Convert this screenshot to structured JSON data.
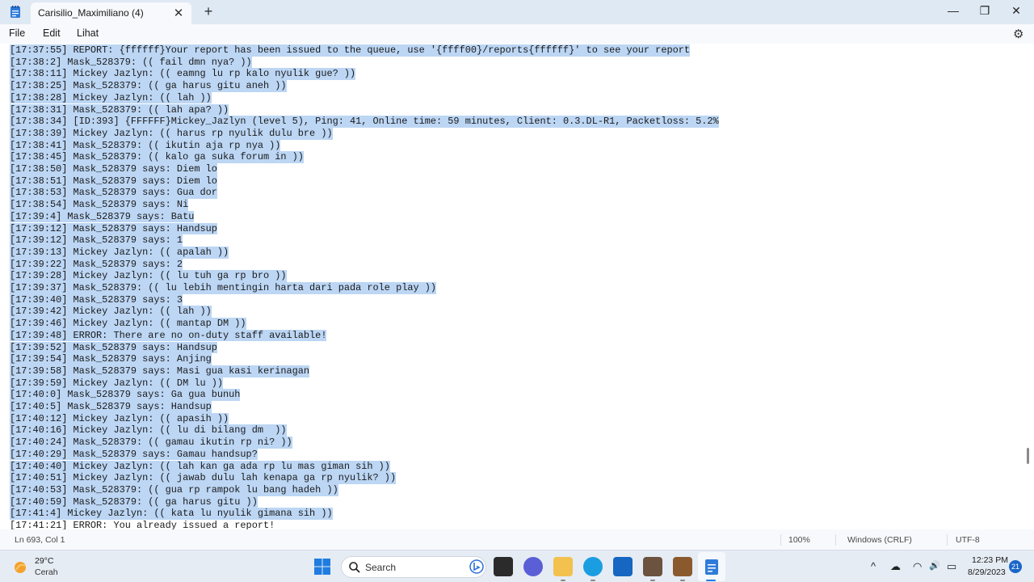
{
  "window": {
    "tab_title": "Carisilio_Maximiliano (4)",
    "close_tab_glyph": "✕",
    "new_tab_glyph": "+",
    "minimize_glyph": "—",
    "maximize_glyph": "❐",
    "close_glyph": "✕"
  },
  "menu": {
    "file": "File",
    "edit": "Edit",
    "view": "Lihat",
    "settings_icon": "⚙"
  },
  "editor": {
    "selection_color": "#bcd6f4",
    "lines": [
      "[17:37:55] REPORT: {ffffff}Your report has been issued to the queue, use '{ffff00}/reports{ffffff}' to see your report",
      "[17:38:2] Mask_528379: (( fail dmn nya? ))",
      "[17:38:11] Mickey Jazlyn: (( eamng lu rp kalo nyulik gue? ))",
      "[17:38:25] Mask_528379: (( ga harus gitu aneh ))",
      "[17:38:28] Mickey Jazlyn: (( lah ))",
      "[17:38:31] Mask_528379: (( lah apa? ))",
      "[17:38:34] [ID:393] {FFFFFF}Mickey_Jazlyn (level 5), Ping: 41, Online time: 59 minutes, Client: 0.3.DL-R1, Packetloss: 5.2%",
      "[17:38:39] Mickey Jazlyn: (( harus rp nyulik dulu bre ))",
      "[17:38:41] Mask_528379: (( ikutin aja rp nya ))",
      "[17:38:45] Mask_528379: (( kalo ga suka forum in ))",
      "[17:38:50] Mask_528379 says: Diem lo",
      "[17:38:51] Mask_528379 says: Diem lo",
      "[17:38:53] Mask_528379 says: Gua dor",
      "[17:38:54] Mask_528379 says: Ni",
      "[17:39:4] Mask_528379 says: Batu",
      "[17:39:12] Mask_528379 says: Handsup",
      "[17:39:12] Mask_528379 says: 1",
      "[17:39:13] Mickey Jazlyn: (( apalah ))",
      "[17:39:22] Mask_528379 says: 2",
      "[17:39:28] Mickey Jazlyn: (( lu tuh ga rp bro ))",
      "[17:39:37] Mask_528379: (( lu lebih mentingin harta dari pada role play ))",
      "[17:39:40] Mask_528379 says: 3",
      "[17:39:42] Mickey Jazlyn: (( lah ))",
      "[17:39:46] Mickey Jazlyn: (( mantap DM ))",
      "[17:39:48] ERROR: There are no on-duty staff available!",
      "[17:39:52] Mask_528379 says: Handsup",
      "[17:39:54] Mask_528379 says: Anjing",
      "[17:39:58] Mask_528379 says: Masi gua kasi kerinagan",
      "[17:39:59] Mickey Jazlyn: (( DM lu ))",
      "[17:40:0] Mask_528379 says: Ga gua bunuh",
      "[17:40:5] Mask_528379 says: Handsup",
      "[17:40:12] Mickey Jazlyn: (( apasih ))",
      "[17:40:16] Mickey Jazlyn: (( lu di bilang dm  ))",
      "[17:40:24] Mask_528379: (( gamau ikutin rp ni? ))",
      "[17:40:29] Mask_528379 says: Gamau handsup?",
      "[17:40:40] Mickey Jazlyn: (( lah kan ga ada rp lu mas giman sih ))",
      "[17:40:51] Mickey Jazlyn: (( jawab dulu lah kenapa ga rp nyulik? ))",
      "[17:40:53] Mask_528379: (( gua rp rampok lu bang hadeh ))",
      "[17:40:59] Mask_528379: (( ga harus gitu ))",
      "[17:41:4] Mickey Jazlyn: (( kata lu nyulik gimana sih ))",
      "[17:41:21] ERROR: You already issued a report!"
    ],
    "selected_line_count": 40
  },
  "status": {
    "position": "Ln 693, Col 1",
    "zoom": "100%",
    "line_ending": "Windows (CRLF)",
    "encoding": "UTF-8"
  },
  "taskbar": {
    "temperature": "29°C",
    "condition": "Cerah",
    "search_label": "Search",
    "time": "12:23 PM",
    "date": "8/29/2023",
    "notification_count": "21",
    "tray_up": "^",
    "tray_cloud": "☁",
    "tray_wifi": "◠",
    "tray_volume": "🔊",
    "tray_battery": "▭"
  }
}
